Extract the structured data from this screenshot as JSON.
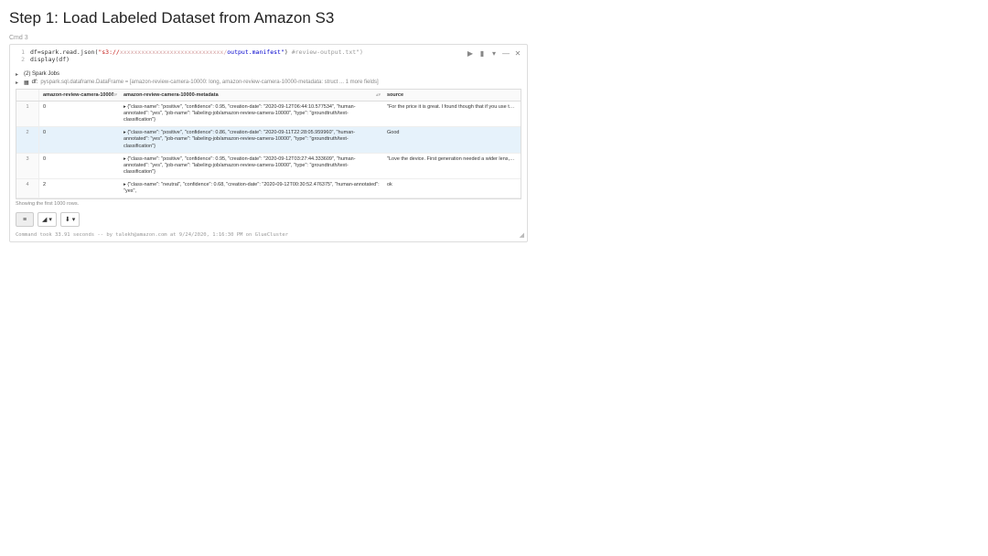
{
  "step_title": "Step 1: Load Labeled Dataset from Amazon S3",
  "cmd_label": "Cmd 3",
  "code": {
    "line1_prefix": "df=spark.read.json(",
    "line1_str_a": "\"s3://",
    "line1_str_mid": "xxxxxxxxxxxxxxxxxxxxxxxxxxxxx/",
    "line1_str_b": "output.manifest\"",
    "line1_suffix": ") ",
    "line1_comment": "#review-output.txt\")",
    "line2": "display(df)"
  },
  "toolbar": {
    "run": "▶",
    "bar": "▮",
    "down": "▾",
    "min": "—",
    "close": "✕"
  },
  "output": {
    "jobs_line": "(2) Spark Jobs",
    "schema_prefix": "df: ",
    "schema_text": "pyspark.sql.dataframe.DataFrame = [amazon-review-camera-10000: long, amazon-review-camera-10000-metadata: struct ... 1 more fields]"
  },
  "table": {
    "headers": [
      "amazon-review-camera-10000",
      "amazon-review-camera-10000-metadata",
      "source"
    ],
    "rows": [
      {
        "idx": "1",
        "a": "0",
        "b": "▸ {\"class-name\": \"positive\", \"confidence\": 0.95, \"creation-date\": \"2020-09-12T06:44:10.577534\", \"human-annotated\": \"yes\", \"job-name\": \"labeling-job/amazon-review-camera-10000\", \"type\": \"groundtruth/text-classification\"}",
        "c": "\"For the price it is great. I found though that if you use the crank the camera up and will come spinning down without support. The ensure the pictures I am taking are steady and level to the ground"
      },
      {
        "idx": "2",
        "a": "0",
        "b": "▸ {\"class-name\": \"positive\", \"confidence\": 0.86, \"creation-date\": \"2020-09-11T22:28:05.959960\", \"human-annotated\": \"yes\", \"job-name\": \"labeling-job/amazon-review-camera-10000\", \"type\": \"groundtruth/text-classification\"}",
        "c": "Good"
      },
      {
        "idx": "3",
        "a": "0",
        "b": "▸ {\"class-name\": \"positive\", \"confidence\": 0.95, \"creation-date\": \"2020-09-12T03:27:44.333609\", \"human-annotated\": \"yes\", \"job-name\": \"labeling-job/amazon-review-camera-10000\", \"type\": \"groundtruth/text-classification\"}",
        "c": "\"Love the device. First generation needed a wider lens, but look"
      },
      {
        "idx": "4",
        "a": "2",
        "b": "▸ {\"class-name\": \"neutral\", \"confidence\": 0.68, \"creation-date\": \"2020-09-12T00:30:52.476375\", \"human-annotated\": \"yes\",",
        "c": "ok"
      }
    ],
    "below": "Showing the first 1000 rows."
  },
  "view_btns": {
    "table": "≡",
    "chart": "◢",
    "down": "▾",
    "dl": "⬇",
    "down2": "▾"
  },
  "drag": "◢",
  "footer": "Command took 33.91 seconds -- by talekh@amazon.com at 9/24/2020, 1:16:30 PM on GlueCluster"
}
